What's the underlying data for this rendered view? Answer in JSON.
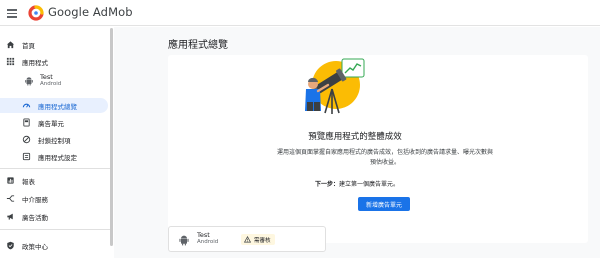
{
  "header": {
    "menu_icon": "hamburger-menu-icon",
    "logo_icon": "admob-logo-icon",
    "brand": "Google AdMob"
  },
  "sidebar": {
    "home": "首頁",
    "apps": "應用程式",
    "current_app": {
      "name": "Test",
      "platform": "Android"
    },
    "app_overview": "應用程式總覽",
    "ad_units": "廣告單元",
    "blocking_controls": "封鎖控制項",
    "app_settings": "應用程式設定",
    "reports": "報表",
    "mediation": "中介服務",
    "campaigns": "廣告活動",
    "policy_center": "政策中心"
  },
  "main": {
    "page_title": "應用程式總覽",
    "card_heading": "預覽應用程式的整體成效",
    "card_body": "運用這個頁面掌握自家應用程式的廣告成效，包括收到的廣告請求量、曝光次數與預估收益。",
    "next_step_label": "下一步：",
    "next_step_text": "建立第一個廣告單元。",
    "cta_label": "新增廣告單元",
    "app_card": {
      "name": "Test",
      "platform": "Android",
      "status_badge": "需審核"
    }
  },
  "colors": {
    "accent": "#1a73e8",
    "active_bg": "#e8f0fe",
    "active_text": "#1967d2",
    "warning_bg": "#fef7e0",
    "warning_icon": "#e37400"
  }
}
